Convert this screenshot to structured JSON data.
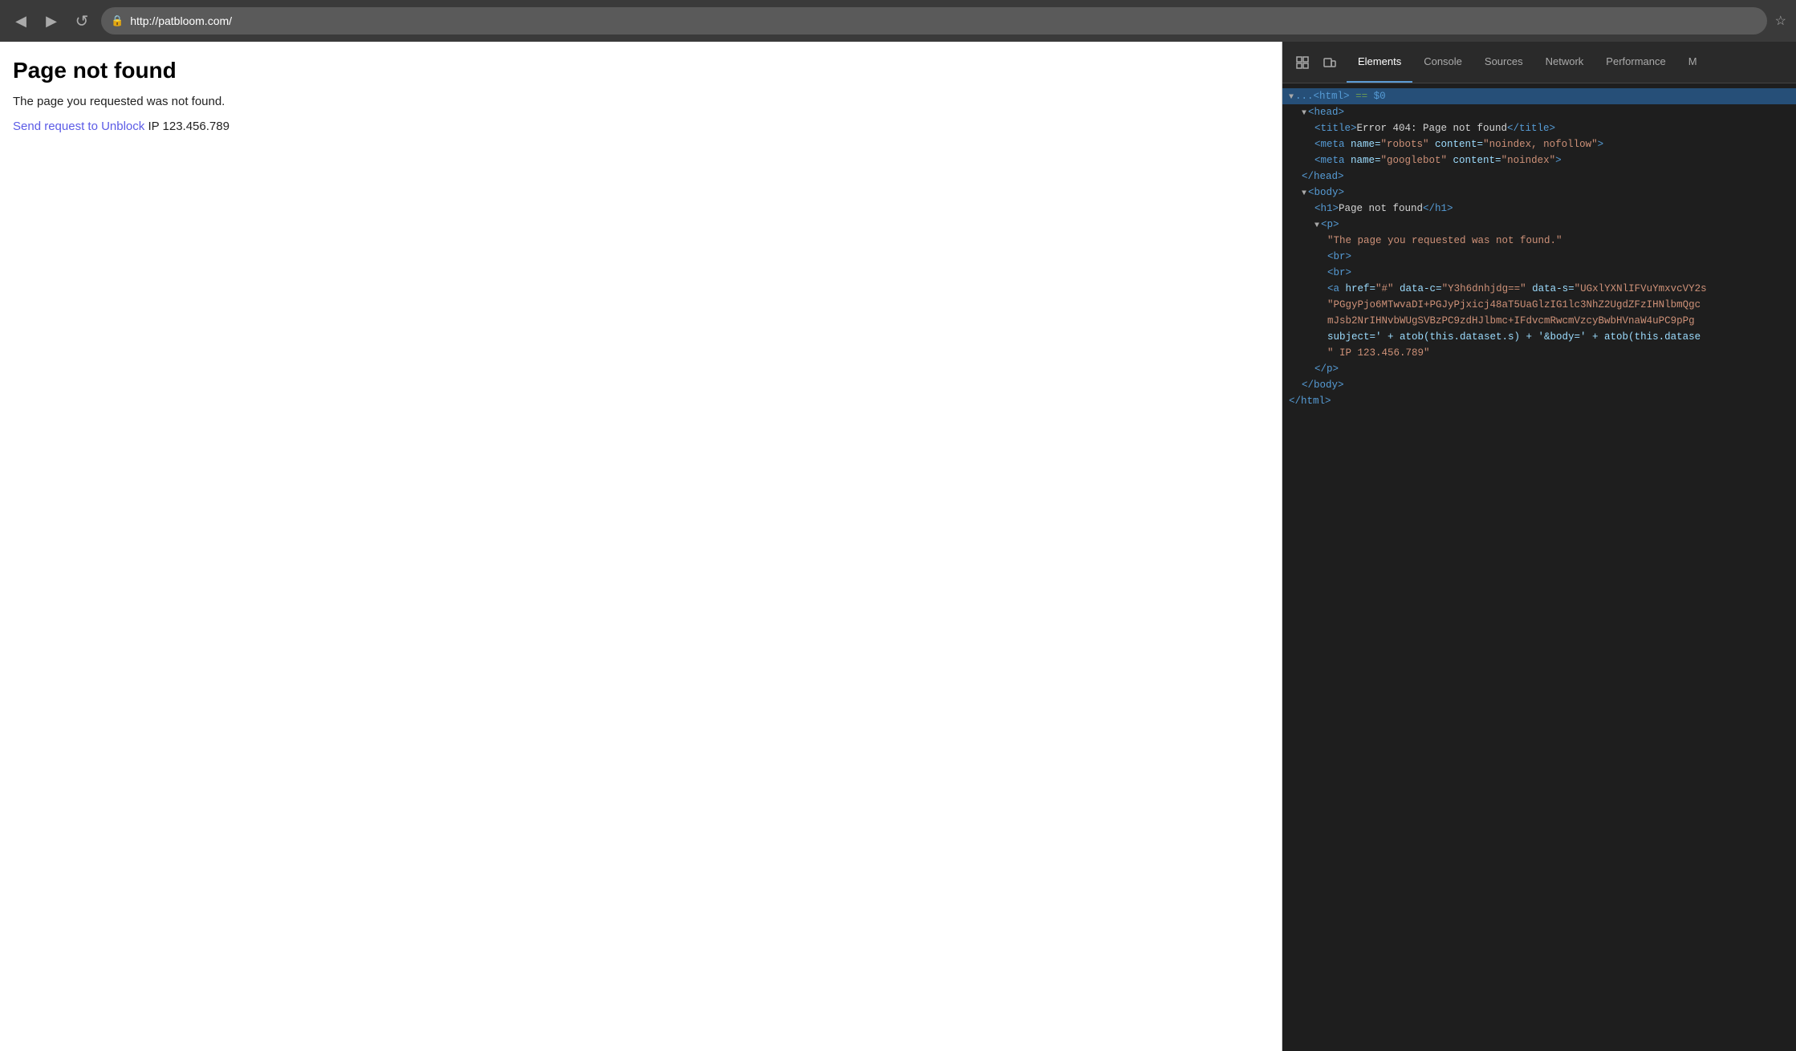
{
  "browser": {
    "url": "http://patbloom.com/",
    "back_label": "◀",
    "forward_label": "▶",
    "reload_label": "↺",
    "bookmark_label": "☆"
  },
  "page": {
    "title": "Page not found",
    "body_text": "The page you requested was not found.",
    "link_text": "Send request to Unblock",
    "ip_text": " IP 123.456.789"
  },
  "devtools": {
    "tabs": [
      "Elements",
      "Console",
      "Sources",
      "Network",
      "Performance",
      "M"
    ],
    "active_tab": "Elements",
    "html_root": "...<html> == $0"
  }
}
